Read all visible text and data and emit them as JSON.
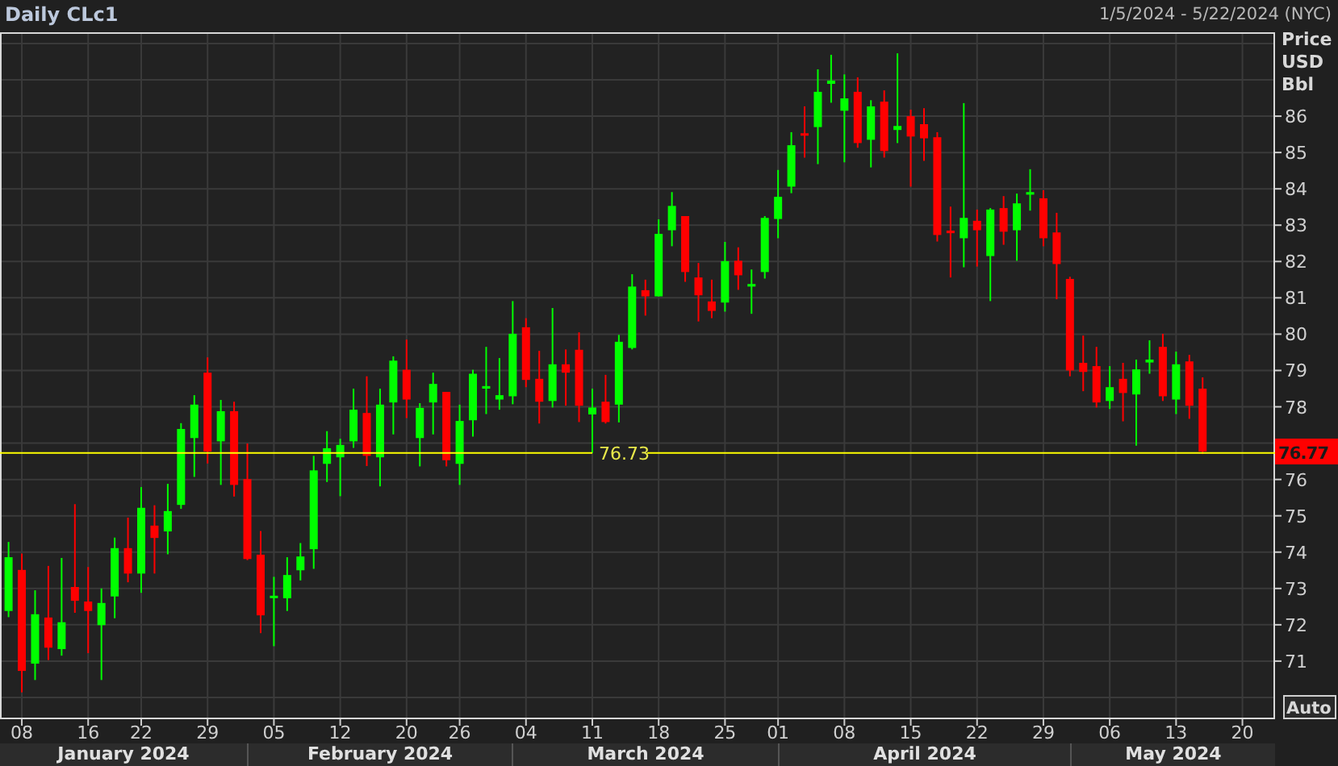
{
  "header": {
    "title": "Daily CLc1",
    "range": "1/5/2024 - 5/22/2024 (NYC)"
  },
  "axis": {
    "unit_lines": [
      "Price",
      "USD",
      "Bbl"
    ],
    "auto_button": "Auto"
  },
  "last_price": {
    "label": "76.77"
  },
  "months": [
    {
      "label": "January 2024"
    },
    {
      "label": "February 2024"
    },
    {
      "label": "March 2024"
    },
    {
      "label": "April 2024"
    },
    {
      "label": "May 2024"
    }
  ],
  "chart_data": {
    "type": "candlestick",
    "categories": [
      null,
      "08",
      null,
      null,
      null,
      null,
      "16",
      null,
      null,
      null,
      "22",
      null,
      null,
      null,
      null,
      "29",
      null,
      null,
      null,
      null,
      "05",
      null,
      null,
      null,
      null,
      "12",
      null,
      null,
      null,
      null,
      "20",
      null,
      null,
      null,
      "26",
      null,
      null,
      null,
      null,
      "04",
      null,
      null,
      null,
      null,
      "11",
      null,
      null,
      null,
      null,
      "18",
      null,
      null,
      null,
      null,
      "25",
      null,
      null,
      null,
      "01",
      null,
      null,
      null,
      null,
      "08",
      null,
      null,
      null,
      null,
      "15",
      null,
      null,
      null,
      null,
      "22",
      null,
      null,
      null,
      null,
      "29",
      null,
      null,
      null,
      null,
      "06",
      null,
      null,
      null,
      null,
      "13",
      null,
      null,
      null,
      null,
      "20"
    ],
    "ohlc": [
      [
        72.38,
        74.28,
        72.21,
        73.86
      ],
      [
        73.51,
        73.96,
        70.14,
        70.73
      ],
      [
        70.93,
        72.95,
        70.48,
        72.29
      ],
      [
        72.2,
        73.62,
        71.03,
        71.37
      ],
      [
        71.33,
        73.84,
        71.15,
        72.07
      ],
      [
        73.04,
        75.32,
        72.33,
        72.66
      ],
      [
        72.64,
        73.59,
        71.22,
        72.38
      ],
      [
        71.99,
        73.0,
        70.48,
        72.6
      ],
      [
        72.78,
        74.4,
        72.18,
        74.11
      ],
      [
        74.11,
        74.95,
        73.17,
        73.41
      ],
      [
        73.41,
        75.79,
        72.88,
        75.22
      ],
      [
        74.73,
        75.29,
        73.41,
        74.39
      ],
      [
        74.57,
        75.88,
        73.94,
        75.13
      ],
      [
        75.3,
        77.55,
        75.19,
        77.39
      ],
      [
        77.14,
        78.32,
        76.07,
        78.06
      ],
      [
        78.94,
        79.36,
        76.44,
        76.77
      ],
      [
        77.05,
        78.19,
        75.85,
        77.88
      ],
      [
        77.88,
        78.14,
        75.53,
        75.85
      ],
      [
        76.01,
        76.99,
        73.78,
        73.81
      ],
      [
        73.93,
        74.58,
        71.77,
        72.26
      ],
      [
        72.75,
        73.32,
        71.41,
        72.8
      ],
      [
        72.73,
        73.86,
        72.38,
        73.37
      ],
      [
        73.5,
        74.25,
        73.22,
        73.88
      ],
      [
        74.08,
        76.65,
        73.54,
        76.25
      ],
      [
        76.43,
        77.33,
        75.93,
        76.86
      ],
      [
        76.61,
        77.12,
        75.54,
        76.95
      ],
      [
        77.05,
        78.5,
        76.87,
        77.92
      ],
      [
        77.83,
        78.84,
        76.37,
        76.65
      ],
      [
        76.61,
        78.5,
        75.81,
        78.06
      ],
      [
        78.12,
        79.39,
        77.24,
        79.27
      ],
      [
        79.02,
        79.85,
        77.69,
        78.2
      ],
      [
        77.14,
        78.1,
        76.36,
        77.97
      ],
      [
        78.12,
        78.94,
        77.24,
        78.63
      ],
      [
        78.41,
        78.41,
        76.36,
        76.53
      ],
      [
        76.43,
        78.06,
        75.85,
        77.61
      ],
      [
        77.63,
        79.02,
        77.18,
        78.91
      ],
      [
        78.5,
        79.65,
        77.8,
        78.57
      ],
      [
        78.2,
        79.34,
        77.92,
        78.32
      ],
      [
        78.29,
        80.91,
        78.07,
        80.01
      ],
      [
        80.19,
        80.44,
        78.54,
        78.74
      ],
      [
        78.77,
        79.54,
        77.54,
        78.14
      ],
      [
        78.16,
        80.72,
        77.98,
        79.17
      ],
      [
        79.17,
        79.58,
        78.03,
        78.94
      ],
      [
        79.57,
        80.05,
        77.58,
        78.03
      ],
      [
        77.79,
        78.5,
        76.73,
        77.98
      ],
      [
        78.14,
        78.88,
        77.54,
        77.58
      ],
      [
        78.06,
        79.98,
        77.57,
        79.79
      ],
      [
        79.62,
        81.65,
        79.58,
        81.31
      ],
      [
        81.21,
        81.5,
        80.51,
        81.04
      ],
      [
        81.04,
        83.16,
        81.04,
        82.76
      ],
      [
        82.86,
        83.91,
        82.42,
        83.53
      ],
      [
        83.25,
        83.25,
        81.44,
        81.71
      ],
      [
        81.56,
        81.96,
        80.35,
        81.07
      ],
      [
        80.9,
        81.5,
        80.44,
        80.64
      ],
      [
        80.87,
        82.54,
        80.62,
        82.01
      ],
      [
        82.02,
        82.39,
        81.22,
        81.62
      ],
      [
        81.31,
        81.78,
        80.56,
        81.38
      ],
      [
        81.71,
        83.25,
        81.53,
        83.2
      ],
      [
        83.17,
        84.52,
        82.64,
        83.78
      ],
      [
        84.06,
        85.56,
        83.88,
        85.2
      ],
      [
        85.53,
        86.27,
        84.86,
        85.5
      ],
      [
        85.7,
        87.29,
        84.68,
        86.67
      ],
      [
        86.89,
        87.69,
        86.37,
        86.98
      ],
      [
        86.15,
        87.15,
        84.73,
        86.49
      ],
      [
        86.67,
        87.07,
        85.13,
        85.26
      ],
      [
        85.35,
        86.44,
        84.59,
        86.27
      ],
      [
        86.4,
        86.71,
        84.86,
        85.04
      ],
      [
        85.62,
        87.73,
        85.26,
        85.73
      ],
      [
        86.0,
        86.18,
        84.06,
        85.44
      ],
      [
        85.78,
        86.22,
        84.77,
        85.39
      ],
      [
        85.42,
        85.56,
        82.55,
        82.73
      ],
      [
        82.85,
        83.51,
        81.56,
        82.78
      ],
      [
        82.64,
        86.36,
        81.84,
        83.2
      ],
      [
        83.12,
        83.43,
        81.86,
        82.86
      ],
      [
        82.15,
        83.47,
        80.91,
        83.43
      ],
      [
        83.47,
        83.8,
        82.46,
        82.82
      ],
      [
        82.86,
        83.87,
        82.02,
        83.6
      ],
      [
        83.84,
        84.54,
        83.4,
        83.91
      ],
      [
        83.74,
        83.96,
        82.42,
        82.64
      ],
      [
        82.8,
        83.34,
        80.96,
        81.93
      ],
      [
        81.52,
        81.58,
        78.84,
        79.0
      ],
      [
        79.21,
        79.96,
        78.43,
        78.96
      ],
      [
        79.12,
        79.65,
        77.98,
        78.12
      ],
      [
        78.16,
        79.12,
        77.94,
        78.54
      ],
      [
        78.77,
        79.21,
        77.6,
        78.38
      ],
      [
        78.34,
        79.3,
        76.93,
        79.03
      ],
      [
        79.22,
        79.83,
        78.91,
        79.3
      ],
      [
        79.65,
        80.01,
        78.16,
        78.29
      ],
      [
        78.2,
        79.52,
        77.8,
        79.17
      ],
      [
        79.25,
        79.43,
        77.67,
        78.03
      ],
      [
        78.5,
        78.81,
        76.7,
        76.77
      ],
      null,
      null,
      null
    ],
    "ylim": [
      69.4,
      88.31
    ],
    "grid": true,
    "yticks": [
      71,
      72,
      73,
      74,
      75,
      76,
      78,
      79,
      80,
      81,
      82,
      83,
      84,
      85,
      86
    ],
    "ref_lines": [
      {
        "axis": "y",
        "value": 76.73,
        "label": "76.73"
      }
    ]
  }
}
